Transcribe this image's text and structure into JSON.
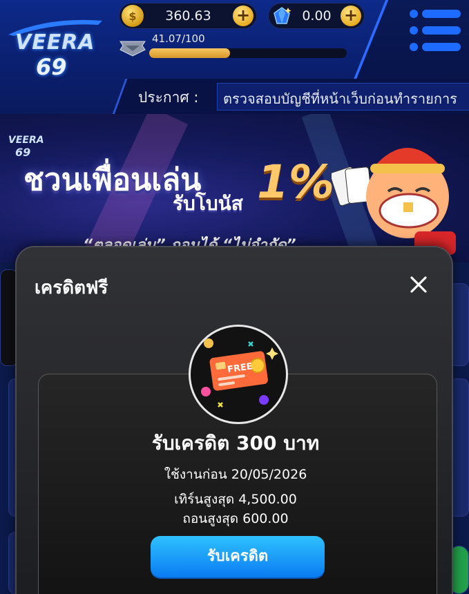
{
  "header": {
    "logo_text": "VEERA",
    "logo_number": "69",
    "balance": "360.63",
    "gems": "0.00",
    "xp_text": "41.07/100",
    "xp_fraction": 0.41,
    "announcement_label": "ประกาศ :",
    "announcement_text": "ตรวจสอบบัญชีที่หน้าเว็บก่อนทำรายการ"
  },
  "banner": {
    "logo_text": "VEERA",
    "logo_number": "69",
    "headline": "ชวนเพื่อนเล่น",
    "sub": "รับโบนัส",
    "percent": "1%",
    "line": "“ตลอดเล่น” ถอนได้ “ไม่จำกัด”"
  },
  "modal": {
    "title": "เครดิตฟรี",
    "badge_text": "FREE",
    "card_title": "รับเครดิต 300 บาท",
    "expire_text": "ใช้งานก่อน 20/05/2026",
    "turnover_text": "เทิร์นสูงสุด 4,500.00",
    "withdraw_text": "ถอนสูงสุด 600.00",
    "claim_label": "รับเครดิต"
  },
  "colors": {
    "accent_blue": "#1e6bff",
    "claim_button": "#0a7cf2",
    "coin_gold": "#e5a818",
    "free_card": "#ff6a3a"
  },
  "icons": {
    "coin": "coin-icon",
    "gem": "gem-icon",
    "plus": "plus-icon",
    "menu": "menu-icon",
    "rank": "rank-badge-icon",
    "close": "close-icon"
  }
}
